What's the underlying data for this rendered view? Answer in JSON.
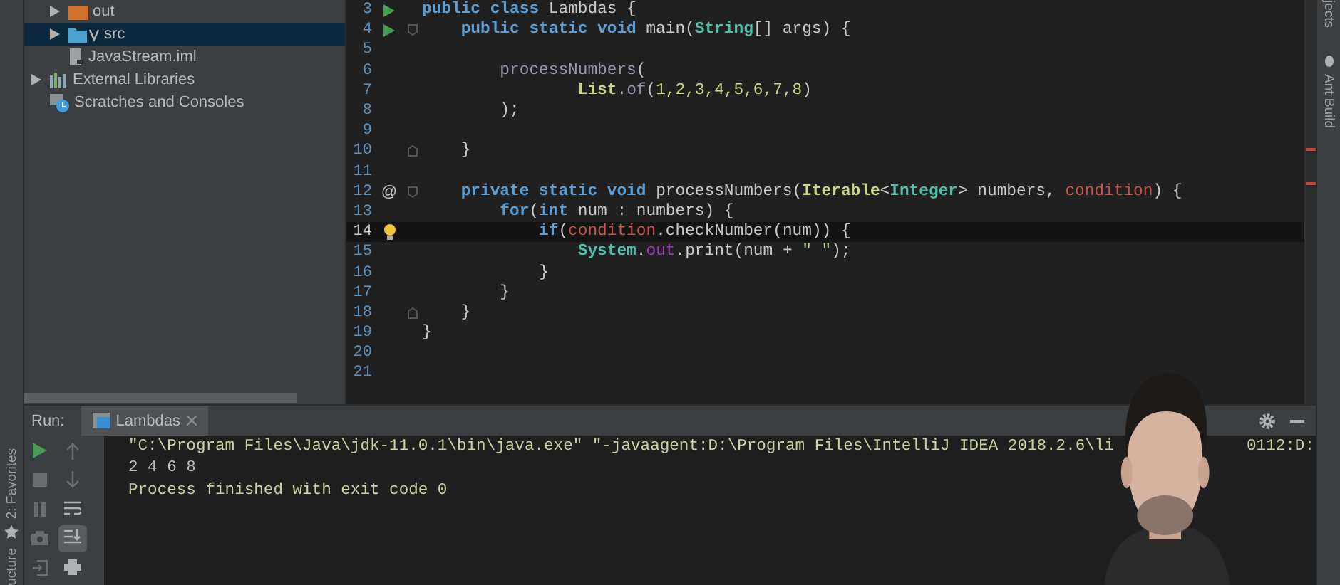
{
  "left_stripe": {
    "tabs": [
      {
        "label": "2: Favorites",
        "kind": "star"
      },
      {
        "label": "ucture",
        "kind": "structure"
      }
    ]
  },
  "project_tree": {
    "continued_children": [
      {
        "label": "out",
        "kind": "folder",
        "expanded": false,
        "selected": false
      },
      {
        "label": "src",
        "kind": "source-folder",
        "expanded": false,
        "selected": true
      },
      {
        "label": "JavaStream.iml",
        "kind": "file",
        "selected": false
      }
    ],
    "items": [
      {
        "label": "External Libraries",
        "kind": "library",
        "expanded": false,
        "selected": false
      },
      {
        "label": "Scratches and Consoles",
        "kind": "scratches",
        "selected": false
      }
    ]
  },
  "editor": {
    "lines": [
      {
        "number": "3",
        "run_marker": true,
        "tokens": [
          {
            "kind": "keyword",
            "text": "public class "
          },
          {
            "kind": "plain",
            "text": "Lambdas {"
          }
        ]
      },
      {
        "number": "4",
        "run_marker": true,
        "fold_open": true,
        "tokens": [
          {
            "kind": "keyword",
            "text": "    public static void "
          },
          {
            "kind": "plain",
            "text": "main("
          },
          {
            "kind": "type",
            "text": "String"
          },
          {
            "kind": "plain",
            "text": "[] args) {"
          }
        ]
      },
      {
        "number": "5"
      },
      {
        "number": "6",
        "tokens": [
          {
            "kind": "muted",
            "text": "        processNumbers"
          },
          {
            "kind": "plain",
            "text": "("
          }
        ]
      },
      {
        "number": "7",
        "tokens": [
          {
            "kind": "class",
            "text": "                List"
          },
          {
            "kind": "plain",
            "text": "."
          },
          {
            "kind": "muted",
            "text": "of"
          },
          {
            "kind": "plain",
            "text": "("
          },
          {
            "kind": "number",
            "text": "1,2,3,4,5,6,7,8"
          },
          {
            "kind": "plain",
            "text": ")"
          }
        ]
      },
      {
        "number": "8",
        "tokens": [
          {
            "kind": "plain",
            "text": "        );"
          }
        ]
      },
      {
        "number": "9"
      },
      {
        "number": "10",
        "fold_close": true,
        "tokens": [
          {
            "kind": "plain",
            "text": "    }"
          }
        ]
      },
      {
        "number": "11"
      },
      {
        "number": "12",
        "gutter_text": "@",
        "fold_open": true,
        "tokens": [
          {
            "kind": "keyword",
            "text": "    private static void "
          },
          {
            "kind": "plain",
            "text": "processNumbers("
          },
          {
            "kind": "class",
            "text": "Iterable"
          },
          {
            "kind": "plain",
            "text": "<"
          },
          {
            "kind": "type",
            "text": "Integer"
          },
          {
            "kind": "plain",
            "text": "> numbers, "
          },
          {
            "kind": "error",
            "text": "condition"
          },
          {
            "kind": "plain",
            "text": ") {"
          }
        ]
      },
      {
        "number": "13",
        "tokens": [
          {
            "kind": "keyword",
            "text": "        for"
          },
          {
            "kind": "plain",
            "text": "("
          },
          {
            "kind": "keyword",
            "text": "int "
          },
          {
            "kind": "plain",
            "text": "num : numbers) {"
          }
        ]
      },
      {
        "number": "14",
        "intention_bulb": true,
        "current": true,
        "tokens": [
          {
            "kind": "keyword",
            "text": "            if"
          },
          {
            "kind": "plain",
            "text": "("
          },
          {
            "kind": "error",
            "text": "condition"
          },
          {
            "kind": "plain",
            "text": ".checkNumber(num)) {"
          }
        ]
      },
      {
        "number": "15",
        "tokens": [
          {
            "kind": "type",
            "text": "                System"
          },
          {
            "kind": "plain",
            "text": "."
          },
          {
            "kind": "field",
            "text": "out"
          },
          {
            "kind": "plain",
            "text": ".print(num + "
          },
          {
            "kind": "string",
            "text": "\" \""
          },
          {
            "kind": "plain",
            "text": ");"
          }
        ]
      },
      {
        "number": "16",
        "tokens": [
          {
            "kind": "plain",
            "text": "            }"
          }
        ]
      },
      {
        "number": "17",
        "tokens": [
          {
            "kind": "plain",
            "text": "        }"
          }
        ]
      },
      {
        "number": "18",
        "fold_close": true,
        "tokens": [
          {
            "kind": "plain",
            "text": "    }"
          }
        ]
      },
      {
        "number": "19",
        "tokens": [
          {
            "kind": "plain",
            "text": "}"
          }
        ]
      },
      {
        "number": "20"
      },
      {
        "number": "21"
      }
    ]
  },
  "right_stripe": {
    "tabs": [
      {
        "label": "jects",
        "kind": "plain"
      },
      {
        "label": "Ant Build",
        "kind": "ant"
      }
    ]
  },
  "run_panel": {
    "label": "Run:",
    "tabs": [
      {
        "label": "Lambdas",
        "selected": true
      }
    ],
    "toolbar": [
      {
        "kind": "run",
        "disabled": false,
        "selected": false
      },
      {
        "kind": "up",
        "disabled": true,
        "selected": false
      },
      {
        "kind": "stop",
        "disabled": true,
        "selected": false
      },
      {
        "kind": "down",
        "disabled": true,
        "selected": false
      },
      {
        "kind": "pause",
        "disabled": true,
        "selected": false
      },
      {
        "kind": "wrap",
        "disabled": false,
        "selected": false
      },
      {
        "kind": "camera",
        "disabled": true,
        "selected": false
      },
      {
        "kind": "scroll-end",
        "disabled": false,
        "selected": true
      },
      {
        "kind": "exit",
        "disabled": true,
        "selected": false
      },
      {
        "kind": "print",
        "disabled": false,
        "selected": false
      }
    ],
    "console": [
      {
        "kind": "system",
        "text": "\"C:\\Program Files\\Java\\jdk-11.0.1\\bin\\java.exe\" \"-javaagent:D:\\Program Files\\IntelliJ IDEA 2018.2.6\\li",
        "trailing": "0112:D:"
      },
      {
        "kind": "output",
        "text": "2 4 6 8"
      },
      {
        "kind": "system",
        "text": "Process finished with exit code 0"
      }
    ]
  }
}
